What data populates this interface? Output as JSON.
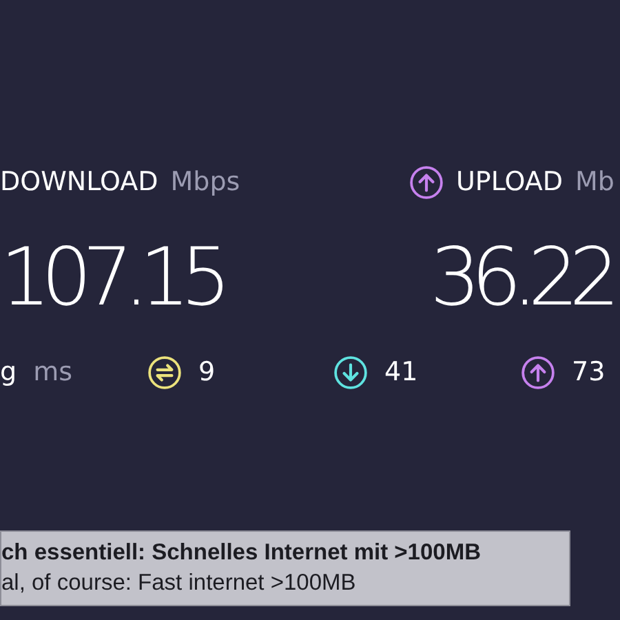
{
  "results": [
    {
      "kind": "download",
      "label": "DOWNLOAD",
      "unit": "Mbps",
      "value": "107.15"
    },
    {
      "kind": "upload",
      "label": "UPLOAD",
      "unit": "Mb",
      "value": "36.22"
    }
  ],
  "stats": [
    {
      "kind": "ping",
      "value": "g",
      "unit": "ms"
    },
    {
      "kind": "jitter",
      "value": "9"
    },
    {
      "kind": "download",
      "value": "41"
    },
    {
      "kind": "upload",
      "value": "73"
    }
  ],
  "subtitle": {
    "line_1": "ch essentiell: Schnelles Internet mit >100MB",
    "line_2": "al, of course: Fast internet >100MB"
  }
}
